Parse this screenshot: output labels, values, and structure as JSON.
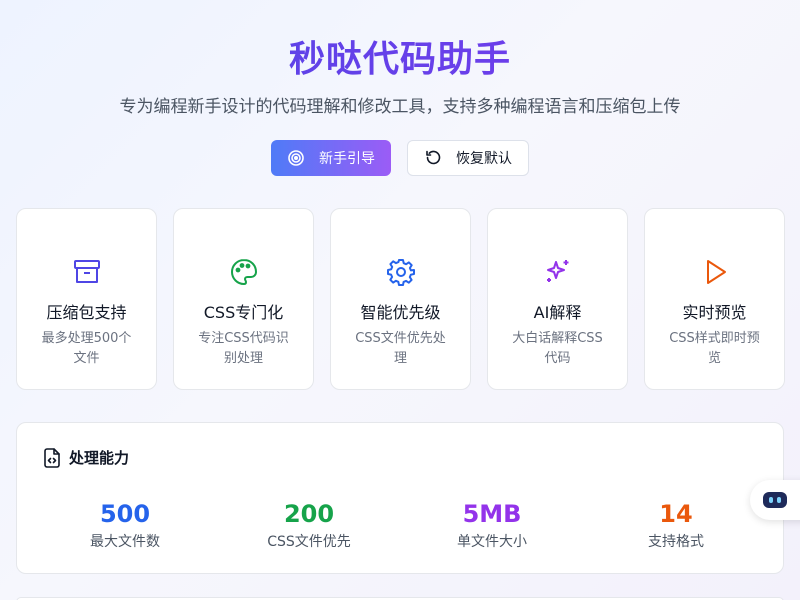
{
  "app": {
    "title": "秒哒代码助手",
    "subtitle": "专为编程新手设计的代码理解和修改工具，支持多种编程语言和压缩包上传"
  },
  "actions": {
    "guide_label": "新手引导",
    "reset_label": "恢复默认"
  },
  "features": [
    {
      "icon": "archive-icon",
      "title": "压缩包支持",
      "desc": "最多处理500个文件",
      "color": "#4f46e5"
    },
    {
      "icon": "palette-icon",
      "title": "CSS专门化",
      "desc": "专注CSS代码识别处理",
      "color": "#16a34a"
    },
    {
      "icon": "gear-icon",
      "title": "智能优先级",
      "desc": "CSS文件优先处理",
      "color": "#2563eb"
    },
    {
      "icon": "sparkles-icon",
      "title": "AI解释",
      "desc": "大白话解释CSS代码",
      "color": "#9333ea"
    },
    {
      "icon": "play-icon",
      "title": "实时预览",
      "desc": "CSS样式即时预览",
      "color": "#ea580c"
    }
  ],
  "capabilities": {
    "title": "处理能力",
    "stats": [
      {
        "value": "500",
        "label": "最大文件数",
        "color": "#2563eb"
      },
      {
        "value": "200",
        "label": "CSS文件优先",
        "color": "#16a34a"
      },
      {
        "value": "5MB",
        "label": "单文件大小",
        "color": "#9333ea"
      },
      {
        "value": "14",
        "label": "支持格式",
        "color": "#ea580c"
      }
    ]
  }
}
